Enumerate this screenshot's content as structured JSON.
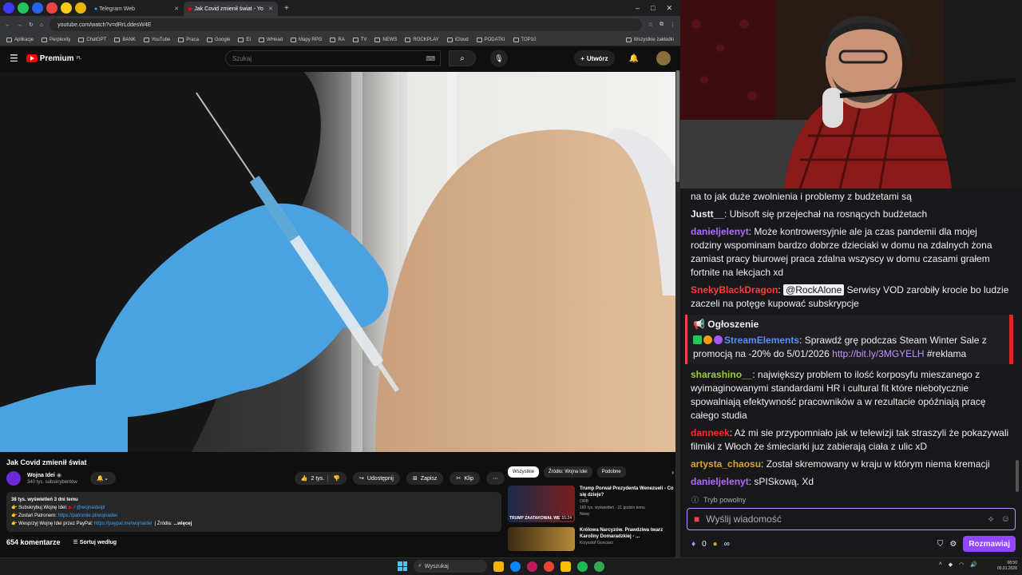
{
  "browser": {
    "tabs": [
      {
        "label": "Telegram Web",
        "active": false
      },
      {
        "label": "Jak Covid zmienił świat - Yo",
        "active": true
      }
    ],
    "url": "youtube.com/watch?v=dRrLddesW4E",
    "bookmarks": [
      "Aplikacje",
      "Perplexity",
      "ChatGPT",
      "BANK",
      "YouTube",
      "Praca",
      "Google",
      "EI",
      "WHead",
      "Mapy RPG",
      "RA",
      "TV",
      "NEWS",
      "ROCKPLAY",
      "iCloud",
      "PODATKI",
      "TOP10",
      "Wszystkie zakładki"
    ]
  },
  "youtube": {
    "logo_text": "Premium",
    "logo_sup": "PL",
    "search_placeholder": "Szukaj",
    "create_label": "Utwórz",
    "video_title": "Jak Covid zmienił świat",
    "channel_name": "Wojna Idei",
    "channel_subs": "340 tys. subskrybentów",
    "likes": "2 tys.",
    "share_label": "Udostępnij",
    "save_label": "Zapisz",
    "clip_label": "Klip",
    "desc_stats": "38 tys. wyświetleń  3 dni temu",
    "desc_line1": "Subskrybuj Wojnę Idei:",
    "desc_line1_handle": "/ @wojnaideipl",
    "desc_line2": "Zostań Patronem:",
    "desc_line2_link": "https://patronite.pl/wojnaidei",
    "desc_line3": "Wesprzyj Wojnę Idei przez PayPal:",
    "desc_line3_link": "https://paypal.me/wojnaidei",
    "desc_sources": "|   Źródła:",
    "desc_more": "...więcej",
    "comments_count": "654 komentarze",
    "sort_label": "Sortuj według",
    "chips": [
      "Wszystkie",
      "Źródło: Wojna Idei",
      "Podobne"
    ],
    "recs": [
      {
        "title": "Trump Porwał Prezydenta Wenezueli - Co się dzieje?",
        "channel": "ORB",
        "meta": "160 tys. wyświetleń · 21 godzin temu",
        "badge": "Nowy",
        "duration": "15:24",
        "thumb_text": "TRUMP ZAATAKOWAŁ WEN"
      },
      {
        "title": "Królowa Narcyzów. Prawdziwa twarz Karoliny Domaradzkiej - ...",
        "channel": "Krzysztof Gonciarz",
        "meta": "",
        "badge": "",
        "duration": "",
        "thumb_text": ""
      }
    ]
  },
  "chat": {
    "messages": [
      {
        "user": "",
        "color": "#efeff1",
        "text": "na to jak duże zwolnienia i problemy z budżetami są"
      },
      {
        "user": "Justt__",
        "color": "#efeff1",
        "text": "Ubisoft się przejechał na rosnących budżetach"
      },
      {
        "user": "danieljelenyt",
        "color": "#b36bff",
        "text": "Może kontrowersyjnie ale ja czas pandemii dla mojej rodziny wspominam bardzo dobrze dzieciaki w domu na zdalnych żona zamiast pracy biurowej praca zdalna wszyscy w domu czasami grałem fortnite na lekcjach xd"
      },
      {
        "user": "SnekyBlackDragon",
        "color": "#ff3b3b",
        "mention": "@RockAlone",
        "text": "Serwisy VOD zarobiły krocie bo ludzie zaczeli na potęge kupować subskrypcje"
      }
    ],
    "announcement": {
      "header": "Ogłoszenie",
      "user": "StreamElements",
      "color": "#5b8def",
      "text": "Sprawdź grę podczas Steam Winter Sale z promocją na -20% do 5/01/2026",
      "link": "http://bit.ly/3MGYELH",
      "tag": "#reklama"
    },
    "messages2": [
      {
        "user": "sharashino__",
        "color": "#9acd32",
        "text": "największy problem to ilość korposyfu mieszanego z wyimaginowanymi standardami HR i cultural fit które niebotycznie spowalniają efektywność pracowników a w rezultacie opóźniają pracę całego studia"
      },
      {
        "user": "danneek",
        "color": "#ff2a2a",
        "text": "Aż mi sie przypomniało jak w telewizji tak straszyli że pokazywali filmiki z Włoch że śmieciarki juz zabierają ciała z ulic xD"
      },
      {
        "user": "artysta_chaosu",
        "color": "#daa520",
        "text": "Został skremowany w kraju w którym niema kremacji"
      },
      {
        "user": "danieljelenyt",
        "color": "#b36bff",
        "text": "sPISkową. Xd"
      }
    ],
    "slow_mode": "Tryb powolny",
    "input_placeholder": "Wyślij wiadomość",
    "points": "0",
    "infinity": "∞",
    "send_label": "Rozmawiaj"
  },
  "taskbar": {
    "search_label": "Wyszukaj",
    "time": "08:50",
    "date": "05.01.2026"
  }
}
